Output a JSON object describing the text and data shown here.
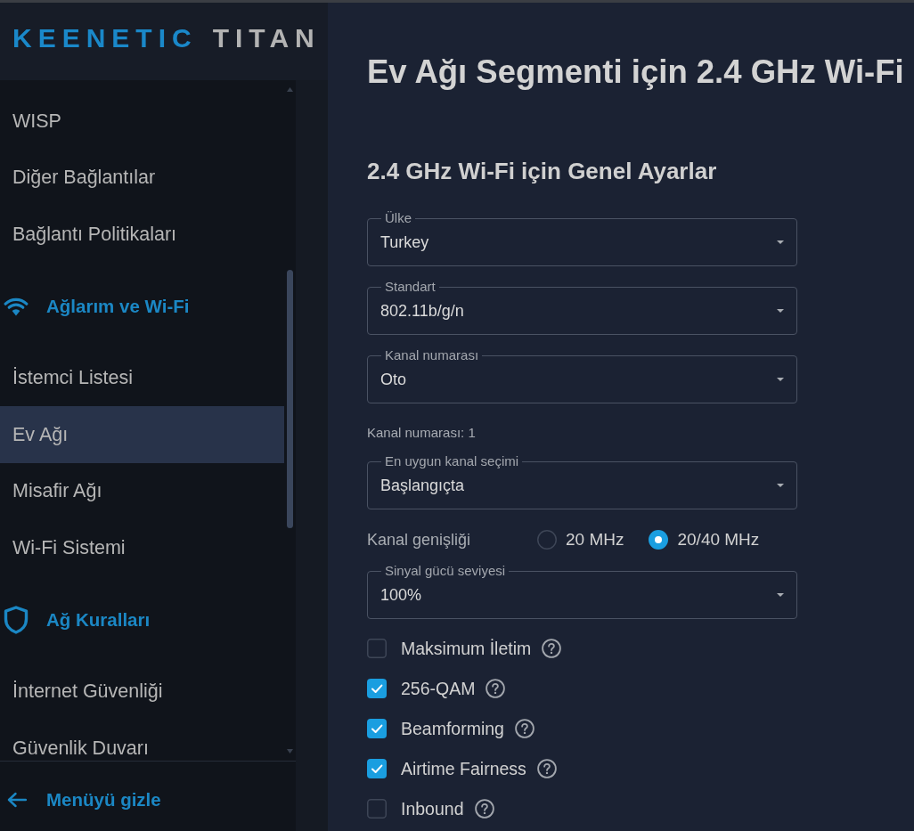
{
  "logo": {
    "brand": "KEENETIC",
    "model": "TITAN"
  },
  "sidebar": {
    "groups": [
      {
        "items": [
          {
            "label": "WISP",
            "selected": false
          },
          {
            "label": "Diğer Bağlantılar",
            "selected": false
          },
          {
            "label": "Bağlantı Politikaları",
            "selected": false
          }
        ]
      },
      {
        "title": "Ağlarım ve Wi-Fi",
        "items": [
          {
            "label": "İstemci Listesi",
            "selected": false
          },
          {
            "label": "Ev Ağı",
            "selected": true
          },
          {
            "label": "Misafir Ağı",
            "selected": false
          },
          {
            "label": "Wi-Fi Sistemi",
            "selected": false
          }
        ]
      },
      {
        "title": "Ağ Kuralları",
        "items": [
          {
            "label": "İnternet Güvenliği",
            "selected": false
          },
          {
            "label": "Güvenlik Duvarı",
            "selected": false
          }
        ]
      }
    ],
    "footer_button": "Menüyü gizle"
  },
  "page_title": "Ev Ağı Segmenti için 2.4 GHz Wi-Fi",
  "section": {
    "title": "2.4 GHz Wi-Fi için Genel Ayarlar",
    "fields": [
      {
        "kind": "select",
        "label": "Ülke",
        "value": "Turkey"
      },
      {
        "kind": "select",
        "label": "Standart",
        "value": "802.11b/g/n"
      },
      {
        "kind": "select",
        "label": "Kanal numarası",
        "value": "Oto"
      },
      {
        "kind": "note",
        "text": "Kanal numarası: 1"
      },
      {
        "kind": "select",
        "label": "En uygun kanal seçimi",
        "value": "Başlangıçta"
      },
      {
        "kind": "radio",
        "label": "Kanal genişliği",
        "options": [
          {
            "label": "20 MHz",
            "selected": false
          },
          {
            "label": "20/40 MHz",
            "selected": true
          }
        ]
      },
      {
        "kind": "select",
        "label": "Sinyal gücü seviyesi",
        "value": "100%"
      },
      {
        "kind": "checkbox",
        "label": "Maksimum İletim",
        "checked": false
      },
      {
        "kind": "checkbox",
        "label": "256-QAM",
        "checked": true
      },
      {
        "kind": "checkbox",
        "label": "Beamforming",
        "checked": true
      },
      {
        "kind": "checkbox",
        "label": "Airtime Fairness",
        "checked": true
      },
      {
        "kind": "checkbox",
        "label": "Inbound",
        "checked": false
      }
    ]
  }
}
